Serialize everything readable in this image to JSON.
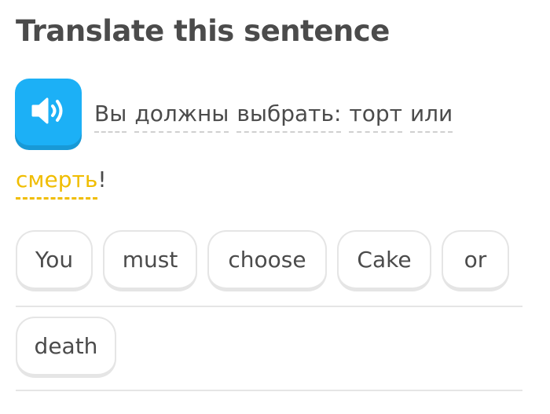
{
  "header": {
    "title": "Translate this sentence"
  },
  "prompt": {
    "speaker_icon": "speaker-icon",
    "words": [
      "Вы",
      "должны",
      "выбрать:",
      "торт",
      "или"
    ],
    "highlight_word": "смерть",
    "punctuation": "!"
  },
  "word_bank": [
    "You",
    "must",
    "choose",
    "Cake",
    "or",
    "death"
  ],
  "colors": {
    "speaker_bg": "#1cb0f6",
    "highlight": "#f0bd00",
    "chip_border": "#e5e5e5",
    "title": "#4b4b4b"
  }
}
